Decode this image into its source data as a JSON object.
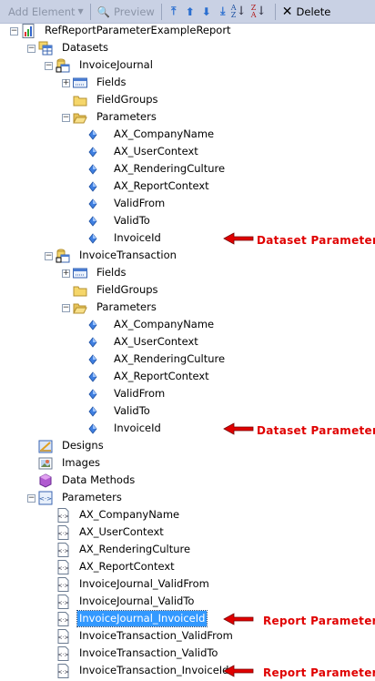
{
  "toolbar": {
    "add_element": "Add Element",
    "preview": "Preview",
    "delete": "Delete",
    "move_top_icon": "move-to-top-icon",
    "move_up_icon": "move-up-icon",
    "move_down_icon": "move-down-icon",
    "move_bottom_icon": "move-to-bottom-icon",
    "sort_asc_icon": "sort-a-z-icon",
    "sort_desc_icon": "sort-z-a-icon"
  },
  "colors": {
    "toolbar_bg": "#c9d1e4",
    "selection": "#3399ff",
    "annotation": "#e00000"
  },
  "tree": [
    {
      "label": "RefReportParameterExampleReport",
      "level": 0,
      "expander": "minus",
      "icon": "report-icon"
    },
    {
      "label": "Datasets",
      "level": 1,
      "expander": "minus",
      "icon": "datasets-icon"
    },
    {
      "label": "InvoiceJournal",
      "level": 2,
      "expander": "minus",
      "icon": "dataset-icon"
    },
    {
      "label": "Fields",
      "level": 3,
      "expander": "plus",
      "icon": "fields-icon"
    },
    {
      "label": "FieldGroups",
      "level": 3,
      "expander": "none",
      "icon": "folder-icon"
    },
    {
      "label": "Parameters",
      "level": 3,
      "expander": "minus",
      "icon": "folder-open-icon"
    },
    {
      "label": "AX_CompanyName",
      "level": 4,
      "expander": "none",
      "icon": "parameter-diamond-icon"
    },
    {
      "label": "AX_UserContext",
      "level": 4,
      "expander": "none",
      "icon": "parameter-diamond-icon"
    },
    {
      "label": "AX_RenderingCulture",
      "level": 4,
      "expander": "none",
      "icon": "parameter-diamond-icon"
    },
    {
      "label": "AX_ReportContext",
      "level": 4,
      "expander": "none",
      "icon": "parameter-diamond-icon"
    },
    {
      "label": "ValidFrom",
      "level": 4,
      "expander": "none",
      "icon": "parameter-diamond-icon"
    },
    {
      "label": "ValidTo",
      "level": 4,
      "expander": "none",
      "icon": "parameter-diamond-icon"
    },
    {
      "label": "InvoiceId",
      "level": 4,
      "expander": "none",
      "icon": "parameter-diamond-icon",
      "annotation": "Dataset Parameter"
    },
    {
      "label": "InvoiceTransaction",
      "level": 2,
      "expander": "minus",
      "icon": "dataset-icon"
    },
    {
      "label": "Fields",
      "level": 3,
      "expander": "plus",
      "icon": "fields-icon"
    },
    {
      "label": "FieldGroups",
      "level": 3,
      "expander": "none",
      "icon": "folder-icon"
    },
    {
      "label": "Parameters",
      "level": 3,
      "expander": "minus",
      "icon": "folder-open-icon"
    },
    {
      "label": "AX_CompanyName",
      "level": 4,
      "expander": "none",
      "icon": "parameter-diamond-icon"
    },
    {
      "label": "AX_UserContext",
      "level": 4,
      "expander": "none",
      "icon": "parameter-diamond-icon"
    },
    {
      "label": "AX_RenderingCulture",
      "level": 4,
      "expander": "none",
      "icon": "parameter-diamond-icon"
    },
    {
      "label": "AX_ReportContext",
      "level": 4,
      "expander": "none",
      "icon": "parameter-diamond-icon"
    },
    {
      "label": "ValidFrom",
      "level": 4,
      "expander": "none",
      "icon": "parameter-diamond-icon"
    },
    {
      "label": "ValidTo",
      "level": 4,
      "expander": "none",
      "icon": "parameter-diamond-icon"
    },
    {
      "label": "InvoiceId",
      "level": 4,
      "expander": "none",
      "icon": "parameter-diamond-icon",
      "annotation": "Dataset Parameter"
    },
    {
      "label": "Designs",
      "level": 1,
      "expander": "none",
      "icon": "designs-icon"
    },
    {
      "label": "Images",
      "level": 1,
      "expander": "none",
      "icon": "images-icon"
    },
    {
      "label": "Data Methods",
      "level": 1,
      "expander": "none",
      "icon": "data-methods-icon"
    },
    {
      "label": "Parameters",
      "level": 1,
      "expander": "minus",
      "icon": "report-parameters-icon"
    },
    {
      "label": "AX_CompanyName",
      "level": 2,
      "expander": "none",
      "icon": "report-parameter-icon"
    },
    {
      "label": "AX_UserContext",
      "level": 2,
      "expander": "none",
      "icon": "report-parameter-icon"
    },
    {
      "label": "AX_RenderingCulture",
      "level": 2,
      "expander": "none",
      "icon": "report-parameter-icon"
    },
    {
      "label": "AX_ReportContext",
      "level": 2,
      "expander": "none",
      "icon": "report-parameter-icon"
    },
    {
      "label": "InvoiceJournal_ValidFrom",
      "level": 2,
      "expander": "none",
      "icon": "report-parameter-icon"
    },
    {
      "label": "InvoiceJournal_ValidTo",
      "level": 2,
      "expander": "none",
      "icon": "report-parameter-icon"
    },
    {
      "label": "InvoiceJournal_InvoiceId",
      "level": 2,
      "expander": "none",
      "icon": "report-parameter-icon",
      "selected": true,
      "annotation": "Report Parameter"
    },
    {
      "label": "InvoiceTransaction_ValidFrom",
      "level": 2,
      "expander": "none",
      "icon": "report-parameter-icon"
    },
    {
      "label": "InvoiceTransaction_ValidTo",
      "level": 2,
      "expander": "none",
      "icon": "report-parameter-icon"
    },
    {
      "label": "InvoiceTransaction_InvoiceId",
      "level": 2,
      "expander": "none",
      "icon": "report-parameter-icon",
      "annotation": "Report Parameter"
    }
  ]
}
